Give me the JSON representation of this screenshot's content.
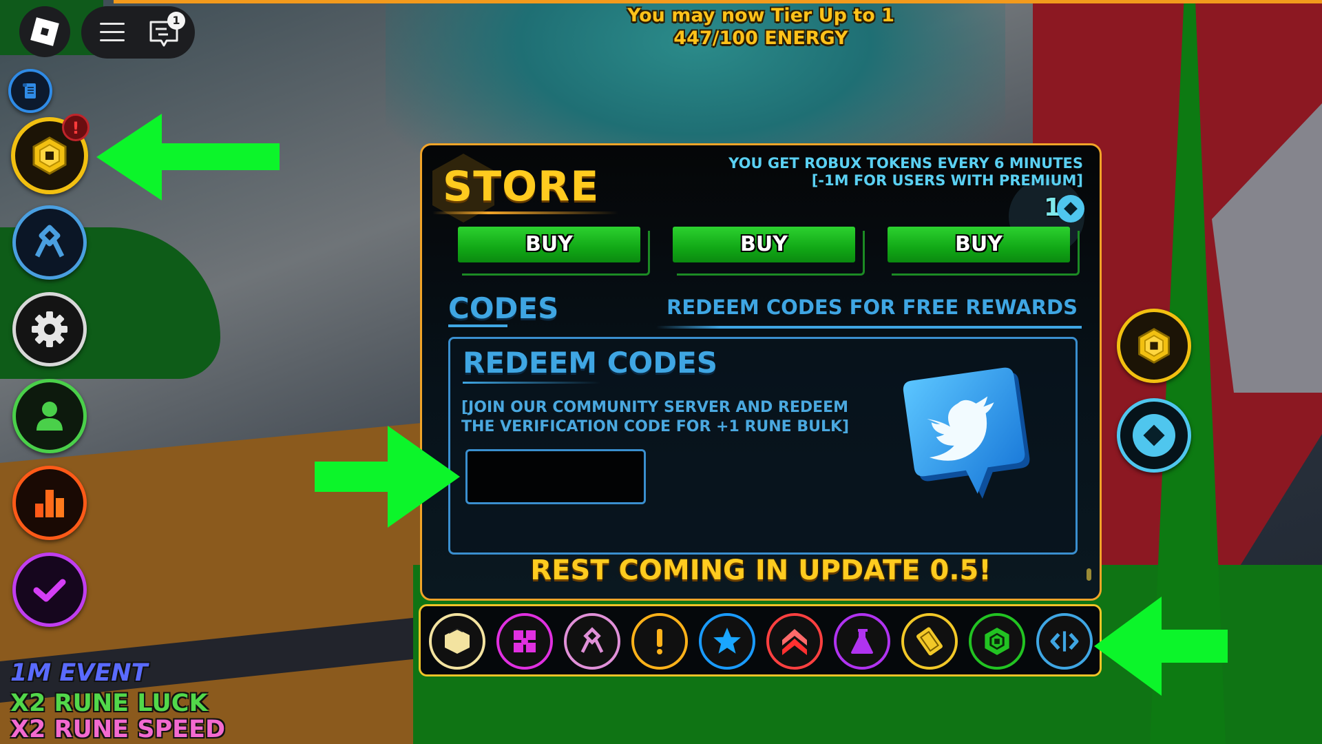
{
  "top_bar": {
    "chat_badge": "1",
    "tier_message_line1": "You may now Tier Up to 1",
    "tier_message_line2": "447/100 ENERGY"
  },
  "left_sidebar": {
    "items": [
      {
        "name": "quests",
        "icon": "scroll-icon",
        "color": "#2f8be6"
      },
      {
        "name": "robux-store",
        "icon": "robux-hex-icon",
        "color": "#f2c011",
        "alert": "!"
      },
      {
        "name": "runes",
        "icon": "rune-icon",
        "color": "#4a9fe0"
      },
      {
        "name": "settings",
        "icon": "gear-icon",
        "color": "#d8d8d8"
      },
      {
        "name": "profile",
        "icon": "user-icon",
        "color": "#4ad04a"
      },
      {
        "name": "stats",
        "icon": "bar-chart-icon",
        "color": "#ff5a18"
      },
      {
        "name": "tasks",
        "icon": "checkmark-icon",
        "color": "#c03ef0"
      }
    ]
  },
  "right_sidebar": {
    "items": [
      {
        "name": "robux-currency",
        "icon": "robux-hex-icon",
        "color": "#f2c011"
      },
      {
        "name": "token-currency",
        "icon": "diamond-token-icon",
        "color": "#4fc6ee"
      }
    ]
  },
  "store": {
    "title": "STORE",
    "info_line1": "YOU GET ROBUX TOKENS EVERY 6 MINUTES",
    "info_line2": "[-1M FOR USERS WITH PREMIUM]",
    "token_count": "1",
    "buy_buttons": [
      "BUY",
      "BUY",
      "BUY"
    ]
  },
  "codes": {
    "section_title": "CODES",
    "section_subtitle": "REDEEM CODES FOR FREE REWARDS",
    "box_title": "REDEEM CODES",
    "description_line1": "[JOIN OUR COMMUNITY SERVER AND REDEEM",
    "description_line2": "THE VERIFICATION CODE FOR +1 RUNE BULK]",
    "input_value": "",
    "input_placeholder": "",
    "footer": "REST COMING IN UPDATE 0.5!"
  },
  "icon_bar": {
    "items": [
      {
        "name": "box",
        "icon": "box-icon",
        "color": "#f3e3a0"
      },
      {
        "name": "crates",
        "icon": "crates-icon",
        "color": "#e030e0"
      },
      {
        "name": "runes",
        "icon": "rune-icon",
        "color": "#e090d8"
      },
      {
        "name": "alerts",
        "icon": "exclamation-icon",
        "color": "#ffb21a"
      },
      {
        "name": "favorites",
        "icon": "star-icon",
        "color": "#1a9bff"
      },
      {
        "name": "upgrades",
        "icon": "double-chevron-up-icon",
        "color": "#ff4040"
      },
      {
        "name": "potions",
        "icon": "flask-icon",
        "color": "#b033f0"
      },
      {
        "name": "tickets",
        "icon": "ticket-icon",
        "color": "#f2c828"
      },
      {
        "name": "robux",
        "icon": "robux-hex-icon",
        "color": "#22c322"
      },
      {
        "name": "codes",
        "icon": "code-icon",
        "color": "#3fa6e3"
      }
    ]
  },
  "event": {
    "title": "1M EVENT",
    "line1": "X2 RUNE LUCK",
    "line2": "X2 RUNE SPEED"
  }
}
